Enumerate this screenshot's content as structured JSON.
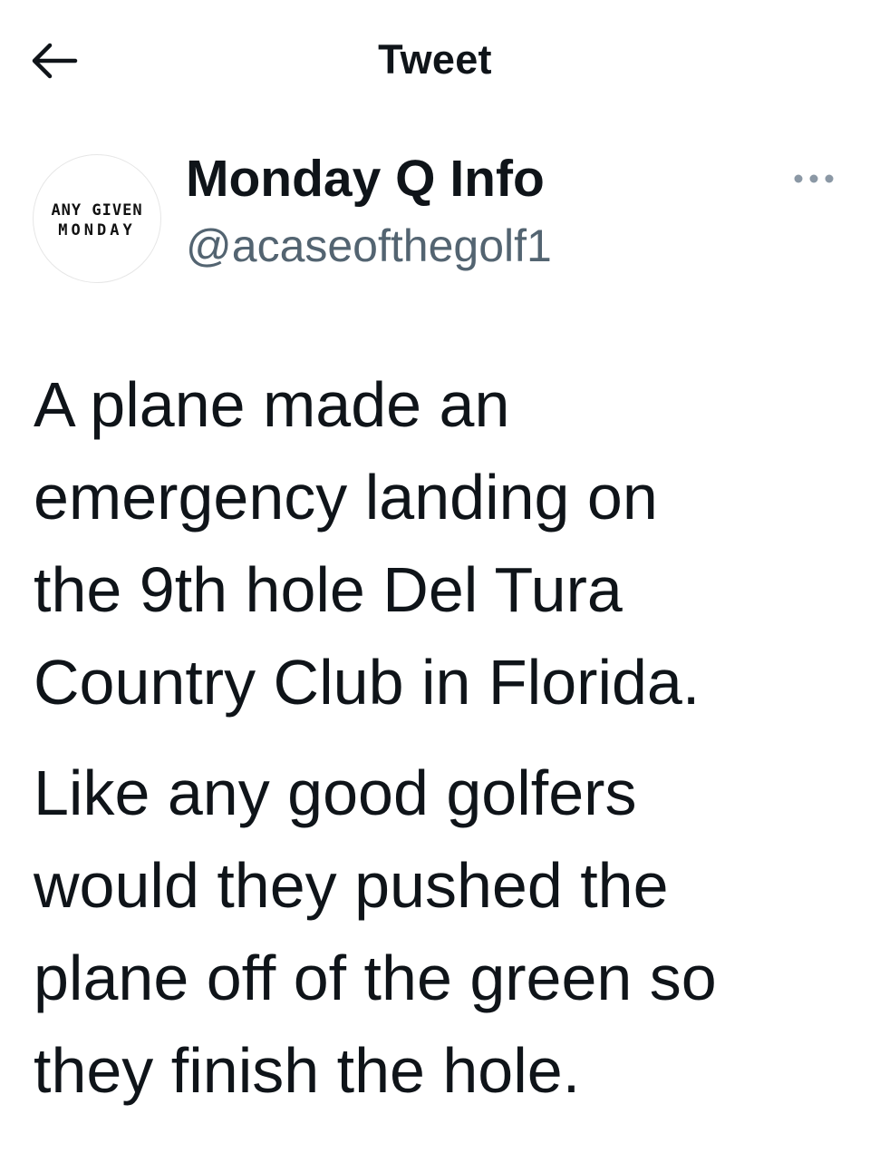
{
  "header": {
    "title": "Tweet",
    "back_icon": "arrow-left-icon"
  },
  "author": {
    "display_name": "Monday Q Info",
    "handle": "@acaseofthegolf1",
    "avatar_text_line1": "ANY GIVEN",
    "avatar_text_line2": "MONDAY",
    "more_icon": "more-horizontal-icon"
  },
  "tweet": {
    "paragraphs": [
      "A plane made an\nemergency landing on\nthe 9th hole Del Tura\nCountry Club in Florida.",
      "Like any good golfers\nwould they pushed the\nplane off of the green so\nthey finish the hole."
    ]
  },
  "colors": {
    "text_primary": "#0f1419",
    "text_secondary": "#536471",
    "icon_gray": "#8b98a5",
    "background": "#ffffff"
  }
}
